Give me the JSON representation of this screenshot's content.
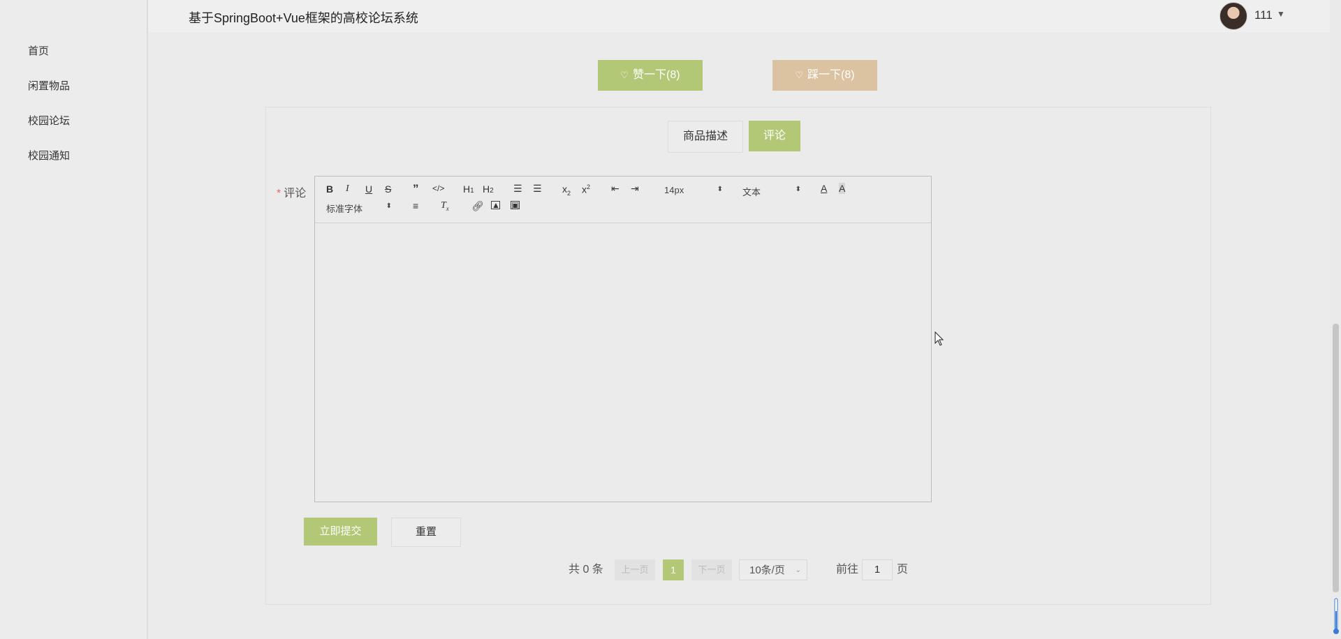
{
  "app": {
    "title": "基于SpringBoot+Vue框架的高校论坛系统"
  },
  "user": {
    "name": "111"
  },
  "sidebar": {
    "items": [
      {
        "label": "首页"
      },
      {
        "label": "闲置物品"
      },
      {
        "label": "校园论坛"
      },
      {
        "label": "校园通知"
      }
    ]
  },
  "reactions": {
    "like_label": "赞一下(8)",
    "dislike_label": "踩一下(8)"
  },
  "tabs": [
    {
      "label": "商品描述",
      "active": false
    },
    {
      "label": "评论",
      "active": true
    }
  ],
  "comment_form": {
    "required_mark": "*",
    "label": "评论",
    "toolbar": {
      "font_size": "14px",
      "paragraph": "文本",
      "font_family": "标准字体"
    },
    "submit_label": "立即提交",
    "reset_label": "重置"
  },
  "pagination": {
    "total_text": "共 0 条",
    "prev_label": "上一页",
    "current_page": "1",
    "next_label": "下一页",
    "page_size": "10条/页",
    "goto_prefix": "前往",
    "goto_value": "1",
    "goto_suffix": "页"
  },
  "colors": {
    "accent_green": "#b2c876",
    "accent_tan": "#dbc3a2",
    "background": "#ebebeb"
  }
}
